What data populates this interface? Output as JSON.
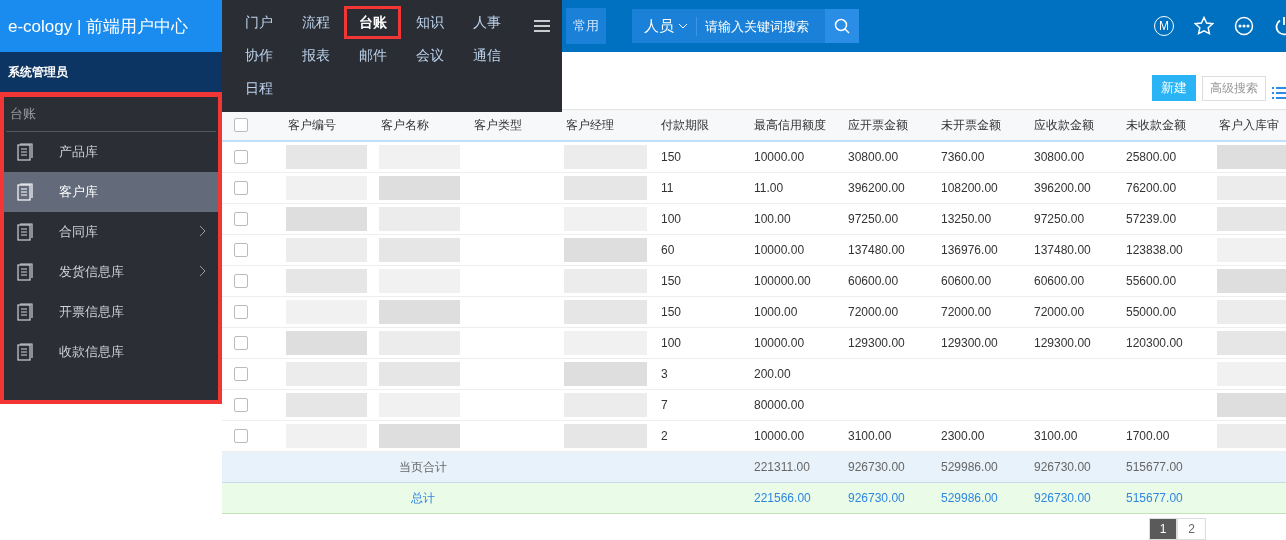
{
  "header": {
    "logo": "e-cology | 前端用户中心",
    "common_button": "常用",
    "search": {
      "scope": "人员",
      "placeholder": "请输入关键词搜索"
    },
    "account_badge": "M"
  },
  "menu": {
    "items": [
      {
        "label": "门户",
        "selected": false,
        "highlighted": false
      },
      {
        "label": "流程",
        "selected": false,
        "highlighted": false
      },
      {
        "label": "台账",
        "selected": true,
        "highlighted": true
      },
      {
        "label": "知识",
        "selected": false,
        "highlighted": false
      },
      {
        "label": "人事",
        "selected": false,
        "highlighted": false
      },
      {
        "label": "协作",
        "selected": false,
        "highlighted": false
      },
      {
        "label": "报表",
        "selected": false,
        "highlighted": false
      },
      {
        "label": "邮件",
        "selected": false,
        "highlighted": false
      },
      {
        "label": "会议",
        "selected": false,
        "highlighted": false
      },
      {
        "label": "通信",
        "selected": false,
        "highlighted": false
      },
      {
        "label": "日程",
        "selected": false,
        "highlighted": false
      }
    ]
  },
  "sidebar": {
    "user": "系统管理员",
    "section": "台账",
    "highlighted": true,
    "items": [
      {
        "label": "产品库",
        "selected": false,
        "expandable": false
      },
      {
        "label": "客户库",
        "selected": true,
        "expandable": false
      },
      {
        "label": "合同库",
        "selected": false,
        "expandable": true
      },
      {
        "label": "发货信息库",
        "selected": false,
        "expandable": true
      },
      {
        "label": "开票信息库",
        "selected": false,
        "expandable": false
      },
      {
        "label": "收款信息库",
        "selected": false,
        "expandable": false
      }
    ]
  },
  "toolbar": {
    "new_button": "新建",
    "advanced_search": "高级搜索"
  },
  "table": {
    "columns": [
      "客户编号",
      "客户名称",
      "客户类型",
      "客户经理",
      "付款期限",
      "最高信用额度",
      "应开票金额",
      "未开票金额",
      "应收款金额",
      "未收款金额",
      "客户入库审"
    ],
    "select_all_checked": false,
    "rows": [
      {
        "checked": false,
        "cells": [
          "",
          "",
          "",
          "",
          "150",
          "10000.00",
          "30800.00",
          "7360.00",
          "30800.00",
          "25800.00",
          ""
        ]
      },
      {
        "checked": false,
        "cells": [
          "",
          "",
          "",
          "",
          "11",
          "11.00",
          "396200.00",
          "108200.00",
          "396200.00",
          "76200.00",
          ""
        ]
      },
      {
        "checked": false,
        "cells": [
          "",
          "",
          "",
          "",
          "100",
          "100.00",
          "97250.00",
          "13250.00",
          "97250.00",
          "57239.00",
          ""
        ]
      },
      {
        "checked": false,
        "cells": [
          "",
          "",
          "",
          "",
          "60",
          "10000.00",
          "137480.00",
          "136976.00",
          "137480.00",
          "123838.00",
          ""
        ]
      },
      {
        "checked": false,
        "cells": [
          "",
          "",
          "",
          "",
          "150",
          "100000.00",
          "60600.00",
          "60600.00",
          "60600.00",
          "55600.00",
          ""
        ]
      },
      {
        "checked": false,
        "cells": [
          "",
          "",
          "",
          "",
          "150",
          "1000.00",
          "72000.00",
          "72000.00",
          "72000.00",
          "55000.00",
          ""
        ]
      },
      {
        "checked": false,
        "cells": [
          "",
          "",
          "",
          "",
          "100",
          "10000.00",
          "129300.00",
          "129300.00",
          "129300.00",
          "120300.00",
          ""
        ]
      },
      {
        "checked": false,
        "cells": [
          "",
          "",
          "",
          "",
          "3",
          "200.00",
          "",
          "",
          "",
          "",
          ""
        ]
      },
      {
        "checked": false,
        "cells": [
          "",
          "",
          "",
          "",
          "7",
          "80000.00",
          "",
          "",
          "",
          "",
          ""
        ]
      },
      {
        "checked": false,
        "cells": [
          "",
          "",
          "",
          "",
          "2",
          "10000.00",
          "3100.00",
          "2300.00",
          "3100.00",
          "1700.00",
          ""
        ]
      }
    ],
    "summaries": [
      {
        "kind": "page",
        "label": "当页合计",
        "values": [
          "221311.00",
          "926730.00",
          "529986.00",
          "926730.00",
          "515677.00"
        ]
      },
      {
        "kind": "total",
        "label": "总计",
        "values": [
          "221566.00",
          "926730.00",
          "529986.00",
          "926730.00",
          "515677.00"
        ]
      }
    ]
  },
  "pager": {
    "pages": [
      {
        "label": "1",
        "selected": true
      },
      {
        "label": "2",
        "selected": false
      }
    ]
  }
}
